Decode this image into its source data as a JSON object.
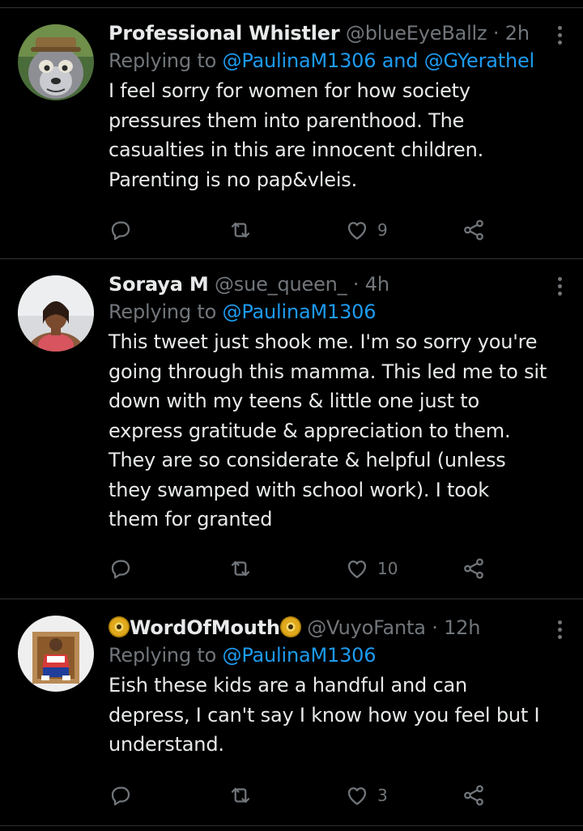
{
  "tweets": [
    {
      "display_name": "Professional Whistler",
      "handle": "@blueEyeBallz",
      "separator": "·",
      "time": "2h",
      "replying_prefix": "Replying to",
      "replying_mentions": [
        "@PaulinaM1306",
        "@GYerathel"
      ],
      "replying_joiner": "and",
      "body_lines": [
        "I feel sorry for women for how society",
        "pressures them into parenthood. The",
        "casualties in this are innocent children.",
        "Parenting is no pap&vleis."
      ],
      "reply_count": "",
      "retweet_count": "",
      "like_count": "9",
      "avatar": "cartoon-lemur-avatar"
    },
    {
      "display_name": "Soraya M",
      "handle": "@sue_queen_",
      "separator": "·",
      "time": "4h",
      "replying_prefix": "Replying to",
      "replying_mentions": [
        "@PaulinaM1306"
      ],
      "body_lines": [
        "This tweet just shook me. I'm so sorry you're",
        "going through this mamma. This led me to sit",
        "down with my teens & little one just to",
        "express gratitude & appreciation to them.",
        "They are so considerate & helpful (unless",
        "they swamped with school work). I took",
        "them for granted"
      ],
      "reply_count": "",
      "retweet_count": "",
      "like_count": "10",
      "avatar": "woman-photo-avatar"
    },
    {
      "display_name": "WordOfMouth",
      "name_emoji": "dvd-disc-emoji",
      "handle": "@VuyoFanta",
      "separator": "·",
      "time": "12h",
      "replying_prefix": "Replying to",
      "replying_mentions": [
        "@PaulinaM1306"
      ],
      "body_lines": [
        "Eish these kids are a handful and can",
        "depress, I can't say I know how you feel but I",
        "understand."
      ],
      "reply_count": "",
      "retweet_count": "",
      "like_count": "3",
      "avatar": "man-photo-avatar"
    }
  ],
  "colors": {
    "background": "#000000",
    "text_primary": "#e7e9ea",
    "text_secondary": "#71767b",
    "mention": "#1d9bf0",
    "divider": "#2f3336"
  },
  "icons": {
    "reply": "reply-icon",
    "retweet": "retweet-icon",
    "like": "heart-icon",
    "share": "share-icon",
    "more": "more-options-icon"
  }
}
